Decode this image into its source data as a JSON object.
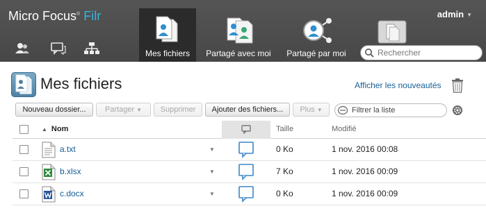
{
  "header": {
    "brand_main": "Micro Focus",
    "brand_reg": "®",
    "brand_product": "Filr",
    "user": "admin",
    "nav": [
      {
        "label": "Mes fichiers",
        "icon": "my-files-icon",
        "active": true
      },
      {
        "label": "Partagé avec moi",
        "icon": "shared-with-me-icon",
        "active": false
      },
      {
        "label": "Partagé par moi",
        "icon": "shared-by-me-icon",
        "active": false
      }
    ],
    "search_placeholder": "Rechercher"
  },
  "page": {
    "title": "Mes fichiers",
    "whats_new": "Afficher les nouveautés"
  },
  "toolbar": {
    "new_folder": "Nouveau dossier...",
    "share": "Partager",
    "delete": "Supprimer",
    "add_files": "Ajouter des fichiers...",
    "more": "Plus",
    "filter_placeholder": "Filtrer la liste"
  },
  "table": {
    "headers": {
      "name": "Nom",
      "size": "Taille",
      "modified": "Modifié"
    },
    "rows": [
      {
        "name": "a.txt",
        "type": "txt",
        "size": "0 Ko",
        "modified": "1 nov. 2016 00:08"
      },
      {
        "name": "b.xlsx",
        "type": "xlsx",
        "size": "7 Ko",
        "modified": "1 nov. 2016 00:09"
      },
      {
        "name": "c.docx",
        "type": "docx",
        "size": "0 Ko",
        "modified": "1 nov. 2016 00:09"
      }
    ]
  },
  "colors": {
    "header_bg": "#4c4c4c",
    "active_nav_bg": "#2b2b2b",
    "brand_accent": "#34b3e4",
    "link": "#135e96",
    "comment_icon": "#3a86c8"
  }
}
